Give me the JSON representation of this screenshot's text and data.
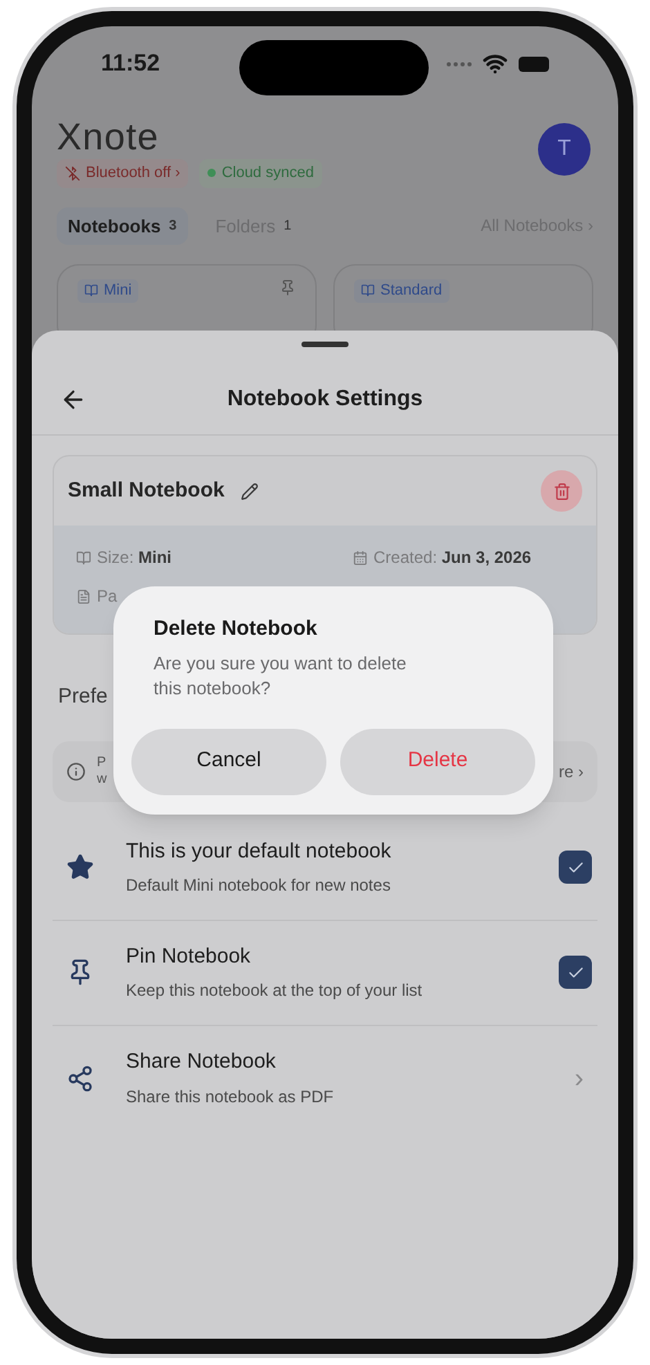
{
  "status_bar": {
    "time": "11:52"
  },
  "app": {
    "logo": "Xnote",
    "avatar": "T",
    "chips": [
      {
        "kind": "bluetooth",
        "label": "Bluetooth off",
        "chevron": "›"
      },
      {
        "kind": "cloud",
        "label": "Cloud synced",
        "color": "#3f8f57"
      }
    ],
    "tabs": [
      {
        "label": "Notebooks",
        "count": "3",
        "selected": true
      },
      {
        "label": "Folders",
        "count": "1",
        "selected": false
      }
    ],
    "all_link": "All Notebooks ›",
    "cards": [
      {
        "label": "Mini",
        "pinned": true
      },
      {
        "label": "Standard",
        "pinned": false
      }
    ]
  },
  "sheet": {
    "title": "Notebook Settings",
    "notebook": {
      "name": "Small Notebook",
      "details": [
        "Size: **Mini**",
        "Created: **Jun 3, 2026**"
      ],
      "pages_fragment": "Pa"
    },
    "section_fragment": "Prefe",
    "info_fragments": {
      "line_1": "P",
      "line_2": "w",
      "right": "re ›"
    },
    "rows": [
      {
        "kind": "checkbox",
        "title": "This is your default notebook",
        "subtitle": "Default Mini notebook for new notes",
        "checked": true
      },
      {
        "kind": "checkbox",
        "title": "Pin Notebook",
        "subtitle": "Keep this notebook at the top of your list",
        "checked": true
      },
      {
        "kind": "link",
        "title": "Share Notebook",
        "subtitle": "Share this notebook as PDF",
        "chevron": "›"
      }
    ]
  },
  "dialog": {
    "title": "Delete Notebook",
    "message": "Are you sure you want to delete this notebook?",
    "buttons": [
      {
        "label": "Cancel",
        "kind": "cancel"
      },
      {
        "label": "Delete",
        "kind": "destructive"
      }
    ]
  }
}
